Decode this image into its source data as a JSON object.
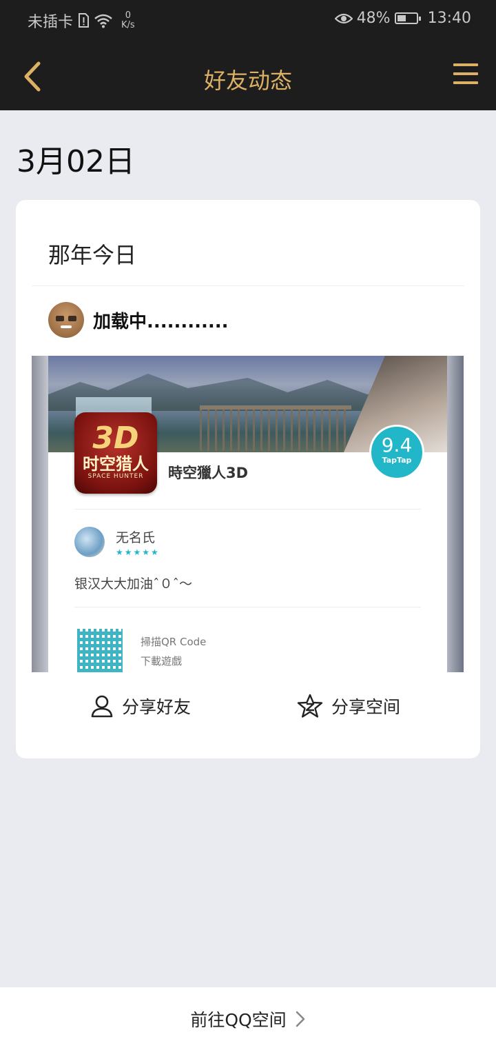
{
  "status_bar": {
    "carrier": "未插卡",
    "speed_value": "0",
    "speed_unit": "K/s",
    "battery": "48%",
    "battery_level": 0.48,
    "time": "13:40",
    "icons": [
      "sim-alert-icon",
      "wifi-icon",
      "eye-icon",
      "battery-icon"
    ]
  },
  "nav": {
    "title": "好友动态",
    "back_icon": "back-chevron-icon",
    "menu_icon": "menu-icon",
    "accent": "#dcb065"
  },
  "feed": {
    "date": "3月02日",
    "card": {
      "title": "那年今日",
      "user_name": "加载中............",
      "shared_image": {
        "app_icon_big": "3D",
        "app_icon_cn": "时空猎人",
        "app_icon_en": "SPACE HUNTER",
        "app_name": "時空獵人3D",
        "score": "9.4",
        "score_label": "TapTap",
        "reviewer_name": "无名氏",
        "reviewer_stars": "★★★★★",
        "review_text": "银汉大大加油ˆ０ˆ～",
        "qr_line1": "掃描QR Code",
        "qr_line2": "下載遊戲"
      },
      "actions": {
        "share_friends": "分享好友",
        "share_space": "分享空间"
      }
    }
  },
  "bottom": {
    "goto_label": "前往QQ空间"
  }
}
